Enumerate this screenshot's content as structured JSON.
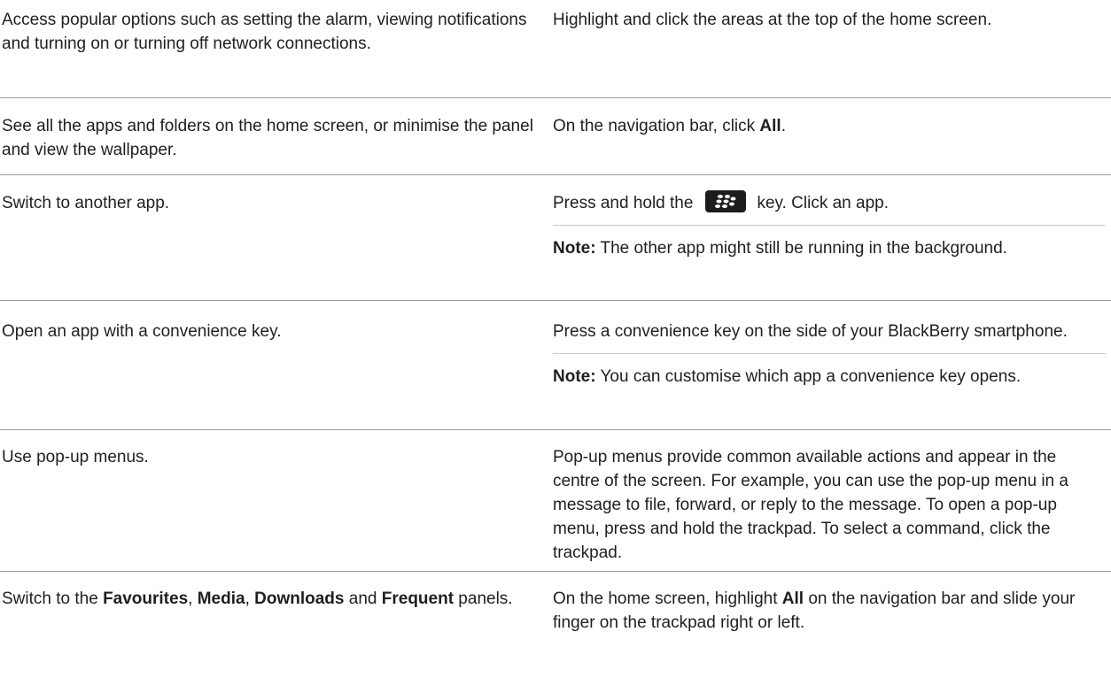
{
  "rows": [
    {
      "task": "Access popular options such as setting the alarm, viewing notifications and turning on or turning off network connections.",
      "step": "Highlight and click the areas at the top of the home screen."
    },
    {
      "task": "See all the apps and folders on the home screen, or minimise the panel and view the wallpaper.",
      "step_prefix": "On the navigation bar, click ",
      "step_bold": "All",
      "step_suffix": "."
    },
    {
      "task": "Switch to another app.",
      "step_prefix": "Press and hold the",
      "key_icon": "blackberry-logo-key-icon",
      "step_suffix": "key. Click an app.",
      "note_label": "Note:",
      "note_text": " The other app might still be running in the background."
    },
    {
      "task": "Open an app with a convenience key.",
      "step": "Press a convenience key on the side of your BlackBerry smartphone.",
      "note_label": "Note:",
      "note_text": " You can customise which app a convenience key opens."
    },
    {
      "task": "Use pop-up menus.",
      "step": "Pop-up menus provide common available actions and appear in the centre of the screen. For example, you can use the pop-up menu in a message to file, forward, or reply to the message. To open a pop-up menu, press and hold the trackpad. To select a command, click the trackpad."
    },
    {
      "task_parts": [
        "Switch to the ",
        "Favourites",
        ", ",
        "Media",
        ", ",
        "Downloads",
        " and ",
        "Frequent",
        " panels."
      ],
      "step_parts": [
        "On the home screen, highlight ",
        "All",
        " on the navigation bar and slide your finger on the trackpad right or left."
      ]
    }
  ]
}
